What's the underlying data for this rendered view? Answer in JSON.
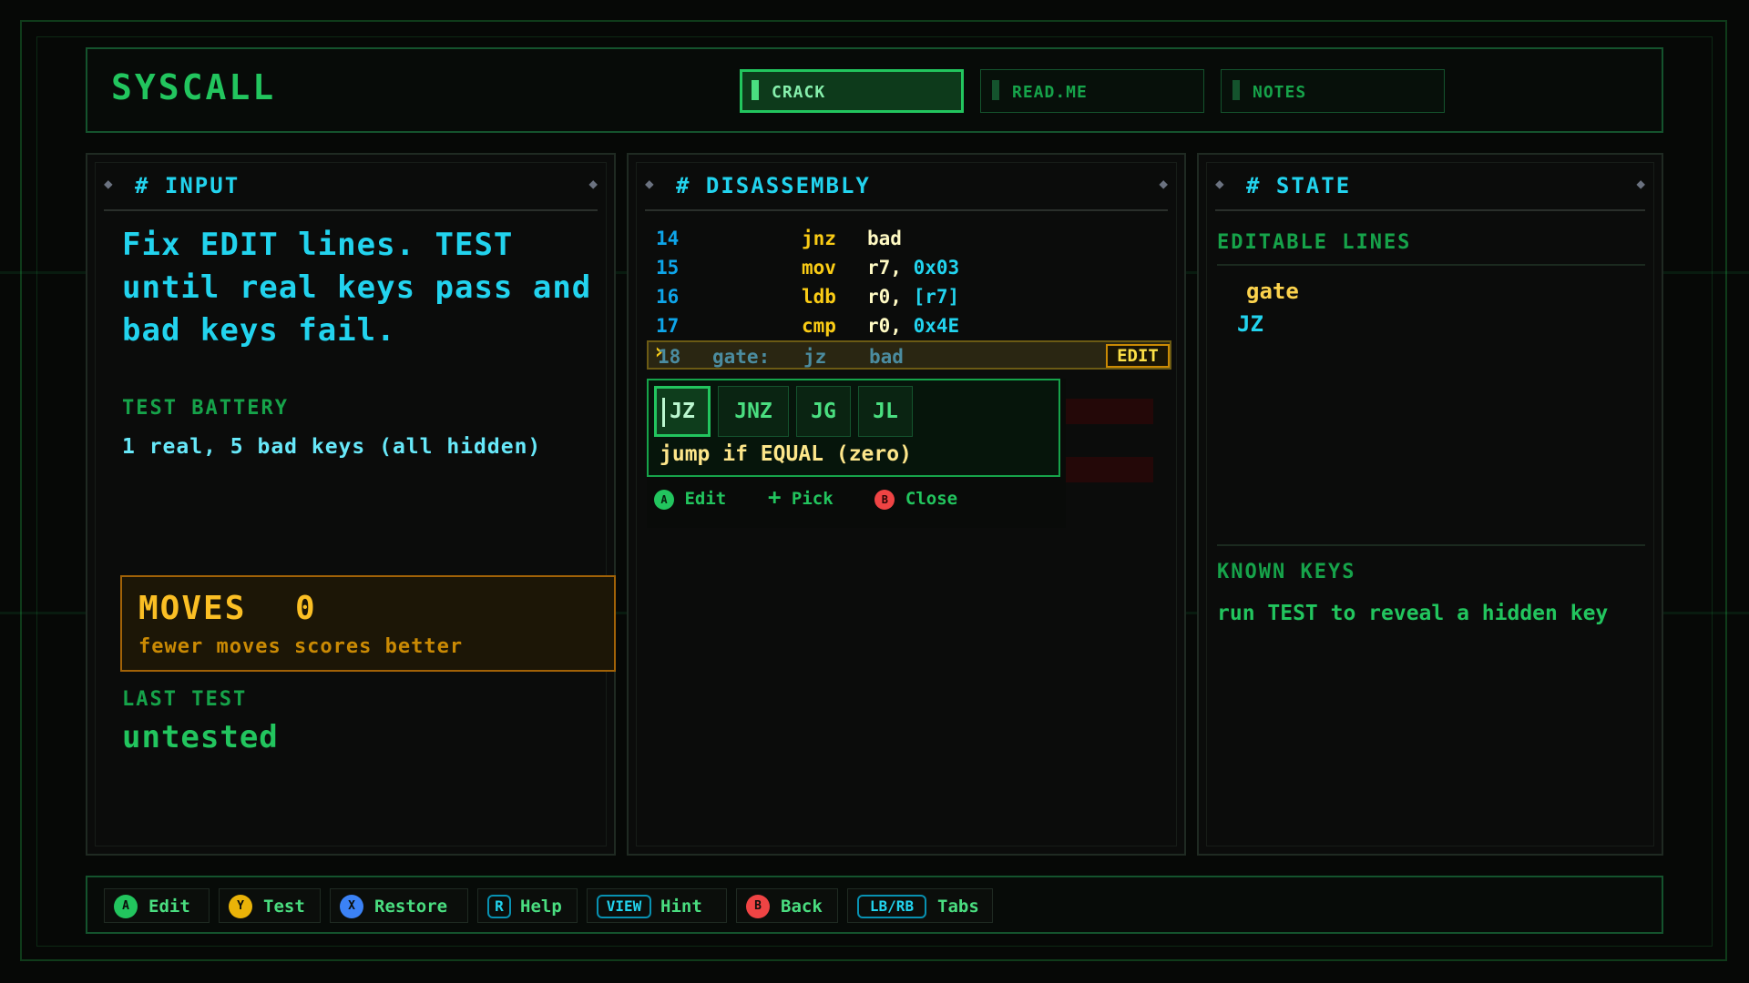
{
  "header": {
    "title": "SYSCALL",
    "tabs": [
      {
        "label": "CRACK",
        "active": true
      },
      {
        "label": "READ.ME",
        "active": false
      },
      {
        "label": "NOTES",
        "active": false
      }
    ]
  },
  "input": {
    "title": "# INPUT",
    "instructions": "Fix EDIT lines. TEST until real keys pass and bad keys fail.",
    "battery_label": "TEST BATTERY",
    "battery_text": "1 real, 5 bad keys (all hidden)",
    "moves_label": "MOVES",
    "moves_value": "0",
    "moves_sub": "fewer moves scores better",
    "last_test_label": "LAST TEST",
    "last_test_value": "untested"
  },
  "disassembly": {
    "title": "# DISASSEMBLY",
    "rows": [
      {
        "num": "14",
        "label": "",
        "op": "jnz",
        "arg": "bad",
        "arg2": ""
      },
      {
        "num": "15",
        "label": "",
        "op": "mov",
        "arg": "r7,",
        "arg2": "0x03"
      },
      {
        "num": "16",
        "label": "",
        "op": "ldb",
        "arg": "r0,",
        "arg2": "[r7]"
      },
      {
        "num": "17",
        "label": "",
        "op": "cmp",
        "arg": "r0,",
        "arg2": "0x4E"
      },
      {
        "num": "18",
        "label": "gate:",
        "op": "jz",
        "arg": "bad",
        "arg2": ""
      }
    ],
    "edit_tag": "EDIT",
    "options": [
      "JZ",
      "JNZ",
      "JG",
      "JL"
    ],
    "selected_option": "JZ",
    "option_desc": "jump if EQUAL (zero)",
    "hints": [
      {
        "glyph": "A",
        "label": "Edit",
        "color": "#22c55e"
      },
      {
        "glyph": "+",
        "label": "Pick",
        "color": "#22c55e"
      },
      {
        "glyph": "B",
        "label": "Close",
        "color": "#ef4444"
      }
    ]
  },
  "state": {
    "title": "# STATE",
    "editable_label": "EDITABLE LINES",
    "editable_name": "gate",
    "editable_value": "JZ",
    "known_label": "KNOWN KEYS",
    "known_text": "run TEST to reveal a hidden key"
  },
  "footer": {
    "buttons": [
      {
        "glyph": "A",
        "label": "Edit",
        "color": "#22c55e",
        "kind": "circle"
      },
      {
        "glyph": "Y",
        "label": "Test",
        "color": "#eab308",
        "kind": "circle"
      },
      {
        "glyph": "X",
        "label": "Restore",
        "color": "#3b82f6",
        "kind": "circle"
      },
      {
        "glyph": "R",
        "label": "Help",
        "color": "#22d3ee",
        "kind": "key"
      },
      {
        "glyph": "VIEW",
        "label": "Hint",
        "color": "#22d3ee",
        "kind": "key"
      },
      {
        "glyph": "B",
        "label": "Back",
        "color": "#ef4444",
        "kind": "circle"
      },
      {
        "glyph": "LB/RB",
        "label": "Tabs",
        "color": "#22d3ee",
        "kind": "key"
      }
    ]
  }
}
